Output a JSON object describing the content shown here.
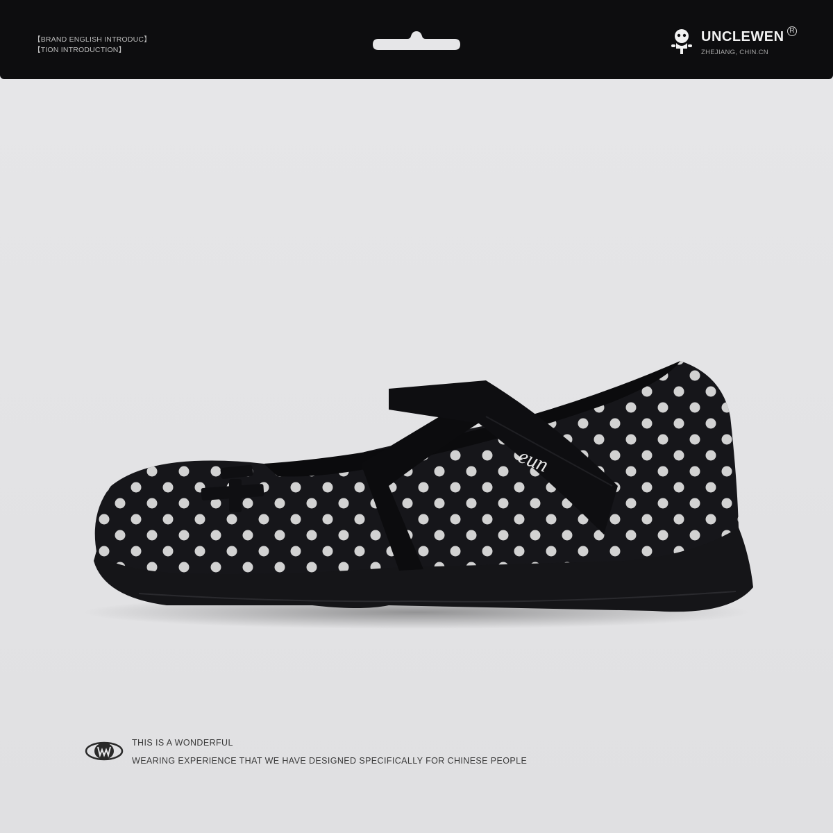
{
  "header": {
    "intro_line1": "【BRAND ENGLISH INTRODUC】",
    "intro_line2": "【TION INTRODUCTION】",
    "brand": "UNCLEWEN",
    "registered": "R",
    "location": "ZHEJIANG, CHIN.CN"
  },
  "product": {
    "strap_logo": "eun",
    "pattern": "black with white polka dots"
  },
  "footer": {
    "tagline_line1": "THIS IS A WONDERFUL",
    "tagline_line2": "WEARING EXPERIENCE THAT WE HAVE DESIGNED SPECIFICALLY FOR CHINESE PEOPLE"
  },
  "colors": {
    "background": "#e6e6e8",
    "header": "#0d0d0f",
    "shoe": "#16161a",
    "dots": "#dcdcdc"
  }
}
